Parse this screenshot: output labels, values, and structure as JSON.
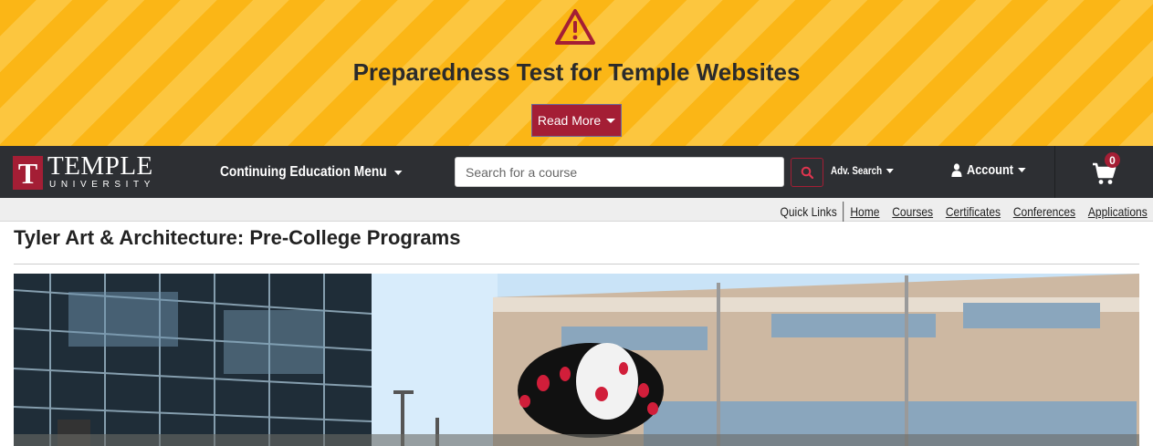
{
  "alert": {
    "icon": "warning-triangle-icon",
    "title": "Preparedness Test for Temple Websites",
    "button_label": "Read More"
  },
  "navbar": {
    "logo": {
      "word": "TEMPLE",
      "sub": "UNIVERSITY",
      "mark": "T"
    },
    "menu_label": "Continuing Education Menu",
    "search_placeholder": "Search for a course",
    "adv_search_label": "Adv. Search",
    "account_label": "Account",
    "cart_count": "0"
  },
  "quicklinks": {
    "label": "Quick Links",
    "links": [
      "Home",
      "Courses",
      "Certificates",
      "Conferences",
      "Applications"
    ]
  },
  "page": {
    "title": "Tyler Art & Architecture: Pre-College Programs"
  },
  "colors": {
    "cherry": "#a41e35",
    "gold": "#fbb616",
    "nav": "#2d2f33"
  }
}
